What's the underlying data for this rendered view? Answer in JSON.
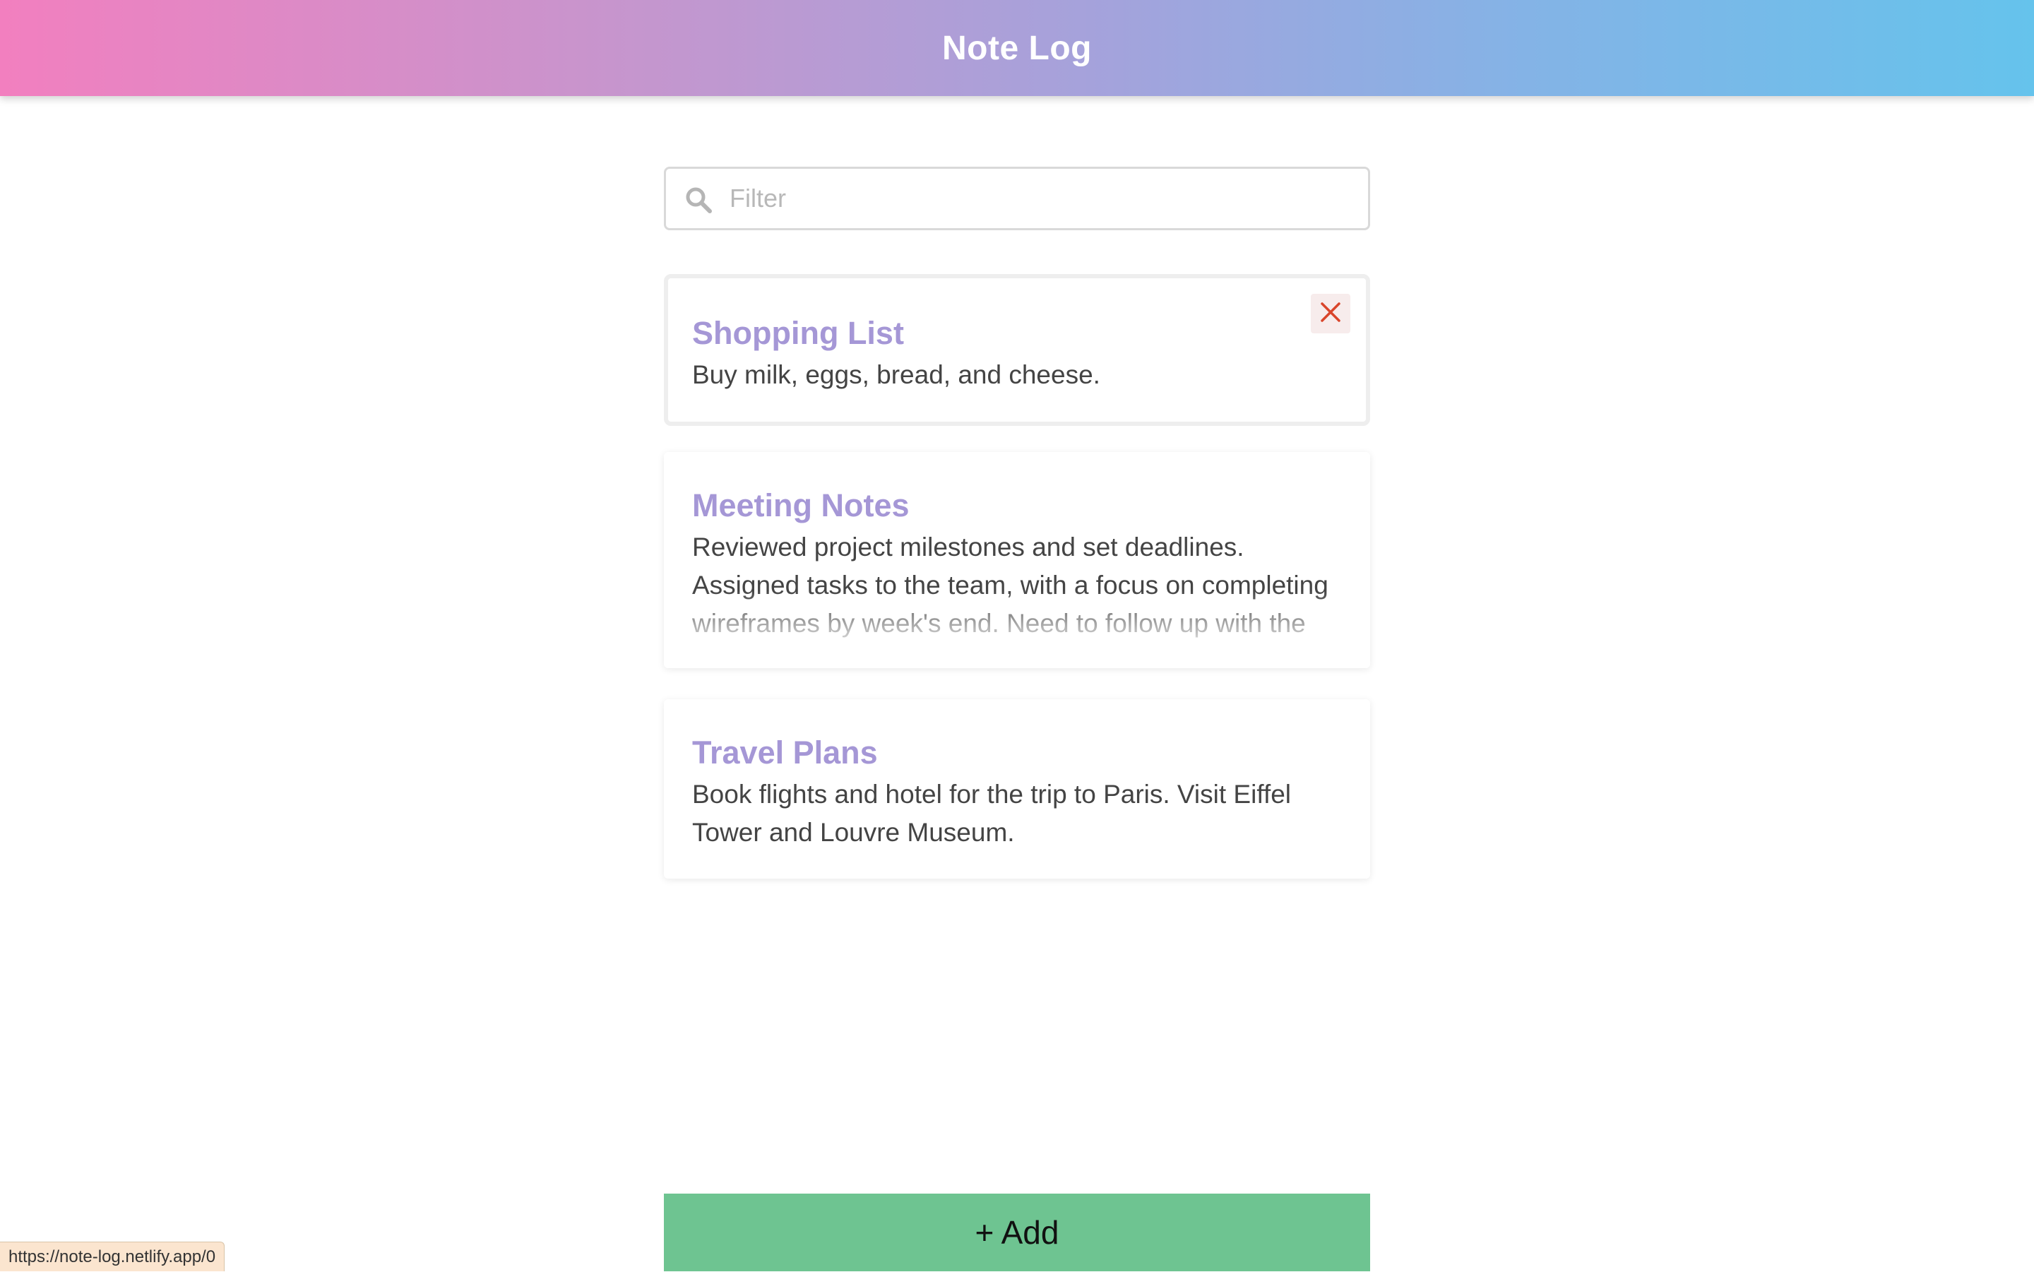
{
  "app": {
    "title": "Note Log"
  },
  "filter": {
    "placeholder": "Filter",
    "value": ""
  },
  "notes": [
    {
      "title": "Shopping List",
      "body": "Buy milk, eggs, bread, and cheese.",
      "active": true
    },
    {
      "title": "Meeting Notes",
      "body": "Reviewed project milestones and set deadlines. Assigned tasks to the team, with a focus on completing wireframes by week's end. Need to follow up with the",
      "active": false
    },
    {
      "title": "Travel Plans",
      "body": "Book flights and hotel for the trip to Paris. Visit Eiffel Tower and Louvre Museum.",
      "active": false
    }
  ],
  "actions": {
    "add_label": "+ Add"
  },
  "status_bar": {
    "url": "https://note-log.netlify.app/0"
  },
  "colors": {
    "header_gradient_start": "#f27fbf",
    "header_gradient_end": "#65c3ec",
    "note_title": "#a597d6",
    "add_button": "#6ec491",
    "delete_icon": "#d9452b"
  },
  "icons": {
    "filter": "search-icon",
    "delete": "close-icon"
  }
}
